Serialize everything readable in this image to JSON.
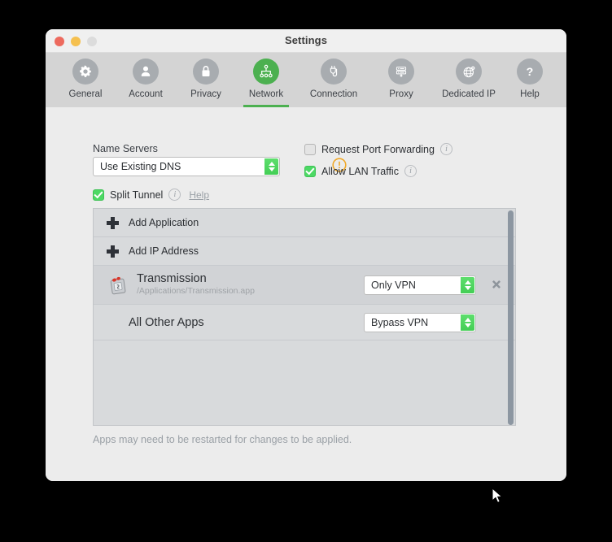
{
  "window": {
    "title": "Settings",
    "controls": [
      {
        "name": "close",
        "color": "#ed6a5e"
      },
      {
        "name": "minimize",
        "color": "#f5c04f"
      },
      {
        "name": "maximize",
        "color": "#dcdcdc"
      }
    ]
  },
  "toolbar": {
    "accent": "#4cb050",
    "active_tab": "Network",
    "tabs": [
      {
        "label": "General",
        "icon": "gear-icon",
        "active": false
      },
      {
        "label": "Account",
        "icon": "person-icon",
        "active": false
      },
      {
        "label": "Privacy",
        "icon": "lock-icon",
        "active": false
      },
      {
        "label": "Network",
        "icon": "network-icon",
        "active": true
      },
      {
        "label": "Connection",
        "icon": "plug-icon",
        "active": false
      },
      {
        "label": "Proxy",
        "icon": "server-icon",
        "active": false
      },
      {
        "label": "Dedicated IP",
        "icon": "globe-pin-icon",
        "active": false
      },
      {
        "label": "Help",
        "icon": "question-icon",
        "active": false
      }
    ]
  },
  "network": {
    "name_servers": {
      "label": "Name Servers",
      "value": "Use Existing DNS",
      "warning_icon": "warning-exclamation-icon"
    },
    "request_port_forwarding": {
      "label": "Request Port Forwarding",
      "checked": false,
      "info_icon": "info-icon"
    },
    "allow_lan_traffic": {
      "label": "Allow LAN Traffic",
      "checked": true,
      "info_icon": "info-icon"
    },
    "split_tunnel": {
      "label": "Split Tunnel",
      "checked": true,
      "info_icon": "info-icon",
      "help_link": "Help"
    },
    "list": {
      "add_application": "Add Application",
      "add_ip_address": "Add IP Address",
      "apps": [
        {
          "name": "Transmission",
          "path": "/Applications/Transmission.app",
          "mode": "Only VPN",
          "icon": "transmission-app-icon",
          "remove_icon": "remove-x-icon"
        }
      ],
      "all_other_apps": {
        "label": "All Other Apps",
        "mode": "Bypass VPN"
      }
    },
    "footnote": "Apps may need to be restarted for changes to be applied."
  }
}
